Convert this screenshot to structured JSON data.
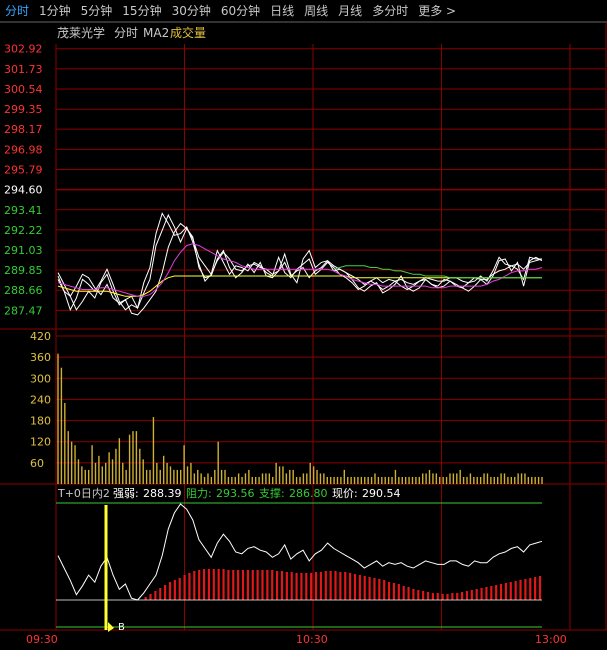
{
  "tabs": [
    "分时",
    "1分钟",
    "5分钟",
    "15分钟",
    "30分钟",
    "60分钟",
    "日线",
    "周线",
    "月线",
    "多分时",
    "更多 >"
  ],
  "active_tab": 0,
  "header": {
    "stock_name": "茂莱光学",
    "period": "分时",
    "ma_label": "MA2",
    "vol_label": "成交量"
  },
  "colors": {
    "accent": "#33a5ff",
    "up": "#ff3333",
    "down": "#33cc33",
    "grid": "#8b0000",
    "white": "#ffffff",
    "yellow": "#ffff33",
    "magenta": "#e040e0",
    "green_line": "#44d044"
  },
  "chart_data": [
    {
      "type": "line",
      "name": "price",
      "y_ticks": [
        "302.92",
        "301.73",
        "300.54",
        "299.35",
        "298.17",
        "296.98",
        "295.79",
        "294.60",
        "293.41",
        "292.22",
        "291.03",
        "289.85",
        "288.66",
        "287.47"
      ],
      "ylim": [
        286.9,
        303.2
      ],
      "x": [
        "09:30",
        "10:30",
        "13:00"
      ],
      "series": [
        {
          "key": "white1",
          "values": [
            289.7,
            289.0,
            288.3,
            287.5,
            288.0,
            288.6,
            288.2,
            289.1,
            289.6,
            288.6,
            287.8,
            288.1,
            287.3,
            287.2,
            287.6,
            288.1,
            288.6,
            289.7,
            291.2,
            292.1,
            292.6,
            292.3,
            291.7,
            290.6,
            290.1,
            289.6,
            290.4,
            290.9,
            290.5,
            289.9,
            289.8,
            290.1,
            290.2,
            290.0,
            289.9,
            289.6,
            289.8,
            290.3,
            289.5,
            289.8,
            290.0,
            289.4,
            289.8,
            290.0,
            290.4,
            290.1,
            289.9,
            289.7,
            289.5,
            289.3,
            289.0,
            289.2,
            289.4,
            289.1,
            289.3,
            289.2,
            289.3,
            289.1,
            289.0,
            289.2,
            289.4,
            289.3,
            289.2,
            289.2,
            289.4,
            289.4,
            289.2,
            289.1,
            289.4,
            289.3,
            289.3,
            289.6,
            289.8,
            289.9,
            290.1,
            290.2,
            289.9,
            290.3,
            290.4,
            290.5
          ]
        },
        {
          "key": "white2",
          "values": [
            289.5,
            288.6,
            287.5,
            288.2,
            289.3,
            289.0,
            288.6,
            289.2,
            289.9,
            289.0,
            288.0,
            287.5,
            287.8,
            287.6,
            288.5,
            289.3,
            291.3,
            292.2,
            293.1,
            292.4,
            291.5,
            292.3,
            291.8,
            290.0,
            289.4,
            289.5,
            290.5,
            291.0,
            290.0,
            289.4,
            289.7,
            290.2,
            289.7,
            290.3,
            289.5,
            289.4,
            289.8,
            290.8,
            289.6,
            289.1,
            290.5,
            291.0,
            290.0,
            290.3,
            290.4,
            289.8,
            289.9,
            289.7,
            289.3,
            288.8,
            288.6,
            288.9,
            289.1,
            288.5,
            288.7,
            289.0,
            289.5,
            288.8,
            288.6,
            288.8,
            289.3,
            289.0,
            288.8,
            288.9,
            289.2,
            289.0,
            288.8,
            288.6,
            288.9,
            289.3,
            289.0,
            289.5,
            290.4,
            290.5,
            289.8,
            290.3,
            288.9,
            290.4,
            290.6,
            290.4
          ]
        },
        {
          "key": "white3",
          "values": [
            289.3,
            288.6,
            288.3,
            288.9,
            289.6,
            289.4,
            288.8,
            288.4,
            289.0,
            288.2,
            287.9,
            288.1,
            288.3,
            287.6,
            289.1,
            290.0,
            292.0,
            293.2,
            292.6,
            291.9,
            292.0,
            292.4,
            291.5,
            290.2,
            289.2,
            289.6,
            291.0,
            290.3,
            289.6,
            290.1,
            290.0,
            289.8,
            290.3,
            290.1,
            289.7,
            289.5,
            290.6,
            289.7,
            289.4,
            289.9,
            290.2,
            290.5,
            289.6,
            289.9,
            290.3,
            290.0,
            289.6,
            289.4,
            289.1,
            288.7,
            288.9,
            289.2,
            289.0,
            288.7,
            288.9,
            289.2,
            288.9,
            288.7,
            288.9,
            289.2,
            289.3,
            289.0,
            288.9,
            289.3,
            289.2,
            288.9,
            288.8,
            289.1,
            289.2,
            289.5,
            289.2,
            289.8,
            290.6,
            290.2,
            290.1,
            289.9,
            289.3,
            290.6,
            290.5,
            290.5
          ]
        },
        {
          "key": "yellow",
          "values": [
            288.9,
            288.8,
            288.7,
            288.6,
            288.6,
            288.6,
            288.6,
            288.6,
            288.6,
            288.5,
            288.4,
            288.3,
            288.3,
            288.3,
            288.4,
            288.6,
            288.9,
            289.2,
            289.4,
            289.5,
            289.5,
            289.5,
            289.5,
            289.5,
            289.5,
            289.5,
            289.5,
            289.5,
            289.5,
            289.5,
            289.5,
            289.5,
            289.5,
            289.5,
            289.5,
            289.5,
            289.5,
            289.5,
            289.5,
            289.5,
            289.5,
            289.5,
            289.5,
            289.5,
            289.5,
            289.5,
            289.5,
            289.5,
            289.4,
            289.4,
            289.4,
            289.4,
            289.4,
            289.4,
            289.4,
            289.4,
            289.4,
            289.4,
            289.4,
            289.4,
            289.4,
            289.4,
            289.4,
            289.4,
            289.4,
            289.4,
            289.4,
            289.4,
            289.4,
            289.4,
            289.4,
            289.4,
            289.4,
            289.4,
            289.4,
            289.4,
            289.4,
            289.4,
            289.4,
            289.4
          ]
        },
        {
          "key": "magenta",
          "values": [
            289.1,
            289.0,
            288.9,
            288.8,
            288.7,
            288.7,
            288.7,
            288.8,
            288.8,
            288.7,
            288.6,
            288.5,
            288.4,
            288.3,
            288.3,
            288.4,
            288.7,
            289.1,
            289.7,
            290.4,
            290.9,
            291.3,
            291.4,
            291.3,
            291.1,
            290.9,
            290.7,
            290.5,
            290.4,
            290.3,
            290.1,
            290.0,
            289.9,
            289.9,
            289.9,
            289.9,
            289.9,
            289.9,
            289.9,
            289.9,
            289.9,
            289.9,
            289.9,
            289.9,
            289.9,
            289.8,
            289.6,
            289.5,
            289.3,
            289.2,
            289.1,
            289.0,
            289.0,
            288.9,
            288.9,
            288.9,
            288.9,
            288.9,
            288.9,
            288.9,
            288.9,
            288.8,
            288.8,
            288.8,
            288.9,
            288.9,
            288.9,
            288.9,
            288.9,
            288.9,
            289.0,
            289.2,
            289.3,
            289.5,
            289.7,
            289.8,
            289.8,
            289.9,
            289.9,
            290.0
          ]
        },
        {
          "key": "green",
          "values": [
            null,
            null,
            null,
            null,
            null,
            null,
            null,
            null,
            null,
            null,
            null,
            null,
            null,
            null,
            null,
            null,
            null,
            null,
            null,
            null,
            null,
            null,
            null,
            null,
            null,
            null,
            null,
            null,
            null,
            null,
            null,
            null,
            null,
            null,
            null,
            null,
            null,
            null,
            null,
            null,
            null,
            null,
            null,
            null,
            null,
            289.9,
            290.0,
            290.1,
            290.1,
            290.1,
            290.1,
            290.0,
            290.0,
            289.9,
            289.9,
            289.8,
            289.8,
            289.7,
            289.6,
            289.6,
            289.5,
            289.5,
            289.5,
            289.5,
            289.4,
            289.4,
            289.4,
            289.4,
            289.4,
            289.4,
            289.4,
            289.4,
            289.4,
            289.4,
            289.4,
            289.4,
            289.4,
            289.4,
            289.4,
            289.4
          ]
        }
      ]
    },
    {
      "type": "bar",
      "name": "volume",
      "y_ticks": [
        "420",
        "360",
        "300",
        "240",
        "180",
        "120",
        "60"
      ],
      "ylim": [
        0,
        420
      ],
      "values": [
        370,
        330,
        230,
        150,
        120,
        110,
        70,
        50,
        40,
        40,
        110,
        60,
        80,
        50,
        60,
        90,
        70,
        100,
        130,
        60,
        40,
        140,
        150,
        150,
        100,
        70,
        40,
        40,
        190,
        60,
        40,
        80,
        60,
        50,
        40,
        40,
        40,
        110,
        50,
        60,
        30,
        40,
        30,
        20,
        30,
        20,
        40,
        120,
        40,
        40,
        20,
        20,
        20,
        30,
        20,
        30,
        40,
        20,
        20,
        20,
        30,
        30,
        30,
        20,
        60,
        50,
        50,
        30,
        40,
        40,
        20,
        20,
        30,
        30,
        60,
        50,
        40,
        30,
        30,
        20,
        20,
        20,
        20,
        20,
        40,
        20,
        20,
        20,
        20,
        20,
        20,
        20,
        20,
        30,
        20,
        20,
        20,
        20,
        20,
        40,
        20,
        20,
        20,
        20,
        20,
        20,
        20,
        30,
        30,
        40,
        30,
        30,
        20,
        20,
        20,
        30,
        30,
        30,
        40,
        20,
        20,
        30,
        20,
        20,
        20,
        30,
        30,
        20,
        20,
        20,
        30,
        30,
        20,
        20,
        20,
        30,
        30,
        30,
        20,
        20,
        20,
        20,
        20
      ]
    },
    {
      "type": "bar",
      "name": "t0",
      "indicator_label": "T+0日内2",
      "stats": [
        {
          "label": "强弱:",
          "value": "288.39",
          "color": "#ffffff"
        },
        {
          "label": "阻力:",
          "value": "293.56",
          "color": "#33cc33"
        },
        {
          "label": "支撑:",
          "value": "286.80",
          "color": "#33cc33"
        },
        {
          "label": "现价:",
          "value": "290.54",
          "color": "#ffffff"
        }
      ],
      "marker": "B",
      "bars": [
        0,
        0,
        0,
        0,
        0,
        0,
        0,
        0,
        0,
        0,
        0,
        0,
        0,
        0,
        0,
        0,
        0,
        0,
        3,
        6,
        9,
        12,
        15,
        18,
        20,
        22,
        25,
        27,
        29,
        30,
        31,
        31,
        31,
        31,
        31,
        30,
        30,
        30,
        30,
        30,
        30,
        30,
        30,
        30,
        30,
        29,
        29,
        28,
        28,
        27,
        27,
        27,
        27,
        28,
        28,
        29,
        29,
        29,
        28,
        28,
        27,
        26,
        25,
        24,
        23,
        22,
        21,
        20,
        18,
        17,
        16,
        14,
        13,
        11,
        10,
        9,
        8,
        7,
        7,
        6,
        6,
        7,
        7,
        8,
        9,
        10,
        11,
        12,
        13,
        14,
        15,
        16,
        17,
        18,
        19,
        20,
        21,
        22,
        23,
        24
      ]
    }
  ]
}
